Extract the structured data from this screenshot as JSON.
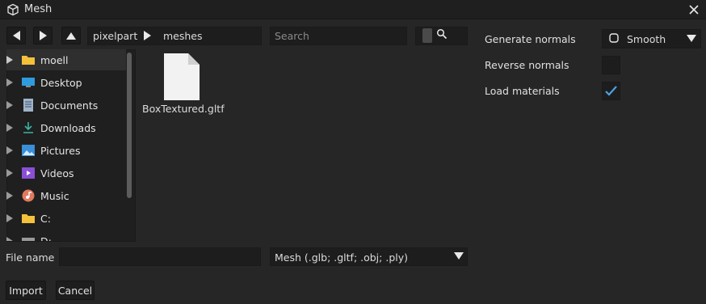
{
  "window": {
    "title": "Mesh",
    "close_icon": "close-icon",
    "title_icon": "cube-icon"
  },
  "nav": {
    "back_icon": "back-arrow-icon",
    "forward_icon": "forward-arrow-icon",
    "up_icon": "parent-folder-icon",
    "breadcrumb": [
      "pixelpart",
      "meshes"
    ],
    "search_placeholder": "Search"
  },
  "sidebar": {
    "items": [
      {
        "label": "moell",
        "icon": "folder-icon"
      },
      {
        "label": "Desktop",
        "icon": "desktop-icon"
      },
      {
        "label": "Documents",
        "icon": "documents-icon"
      },
      {
        "label": "Downloads",
        "icon": "downloads-icon"
      },
      {
        "label": "Pictures",
        "icon": "pictures-icon"
      },
      {
        "label": "Videos",
        "icon": "videos-icon"
      },
      {
        "label": "Music",
        "icon": "music-icon"
      },
      {
        "label": "C:",
        "icon": "folder-icon"
      },
      {
        "label": "D:",
        "icon": "drive-icon"
      }
    ]
  },
  "files": [
    {
      "name": "BoxTextured.gltf",
      "icon": "file-icon"
    }
  ],
  "footer": {
    "filename_label": "File name",
    "filename_value": "",
    "filter_value": "Mesh (.glb; .gltf; .obj; .ply)",
    "import_label": "Import",
    "cancel_label": "Cancel"
  },
  "options": {
    "generate_normals_label": "Generate normals",
    "generate_normals_value": "Smooth",
    "reverse_normals_label": "Reverse normals",
    "reverse_normals_checked": false,
    "load_materials_label": "Load materials",
    "load_materials_checked": true
  },
  "colors": {
    "accent": "#4aa3e0",
    "background": "#262626",
    "field": "#1d1d1d"
  }
}
